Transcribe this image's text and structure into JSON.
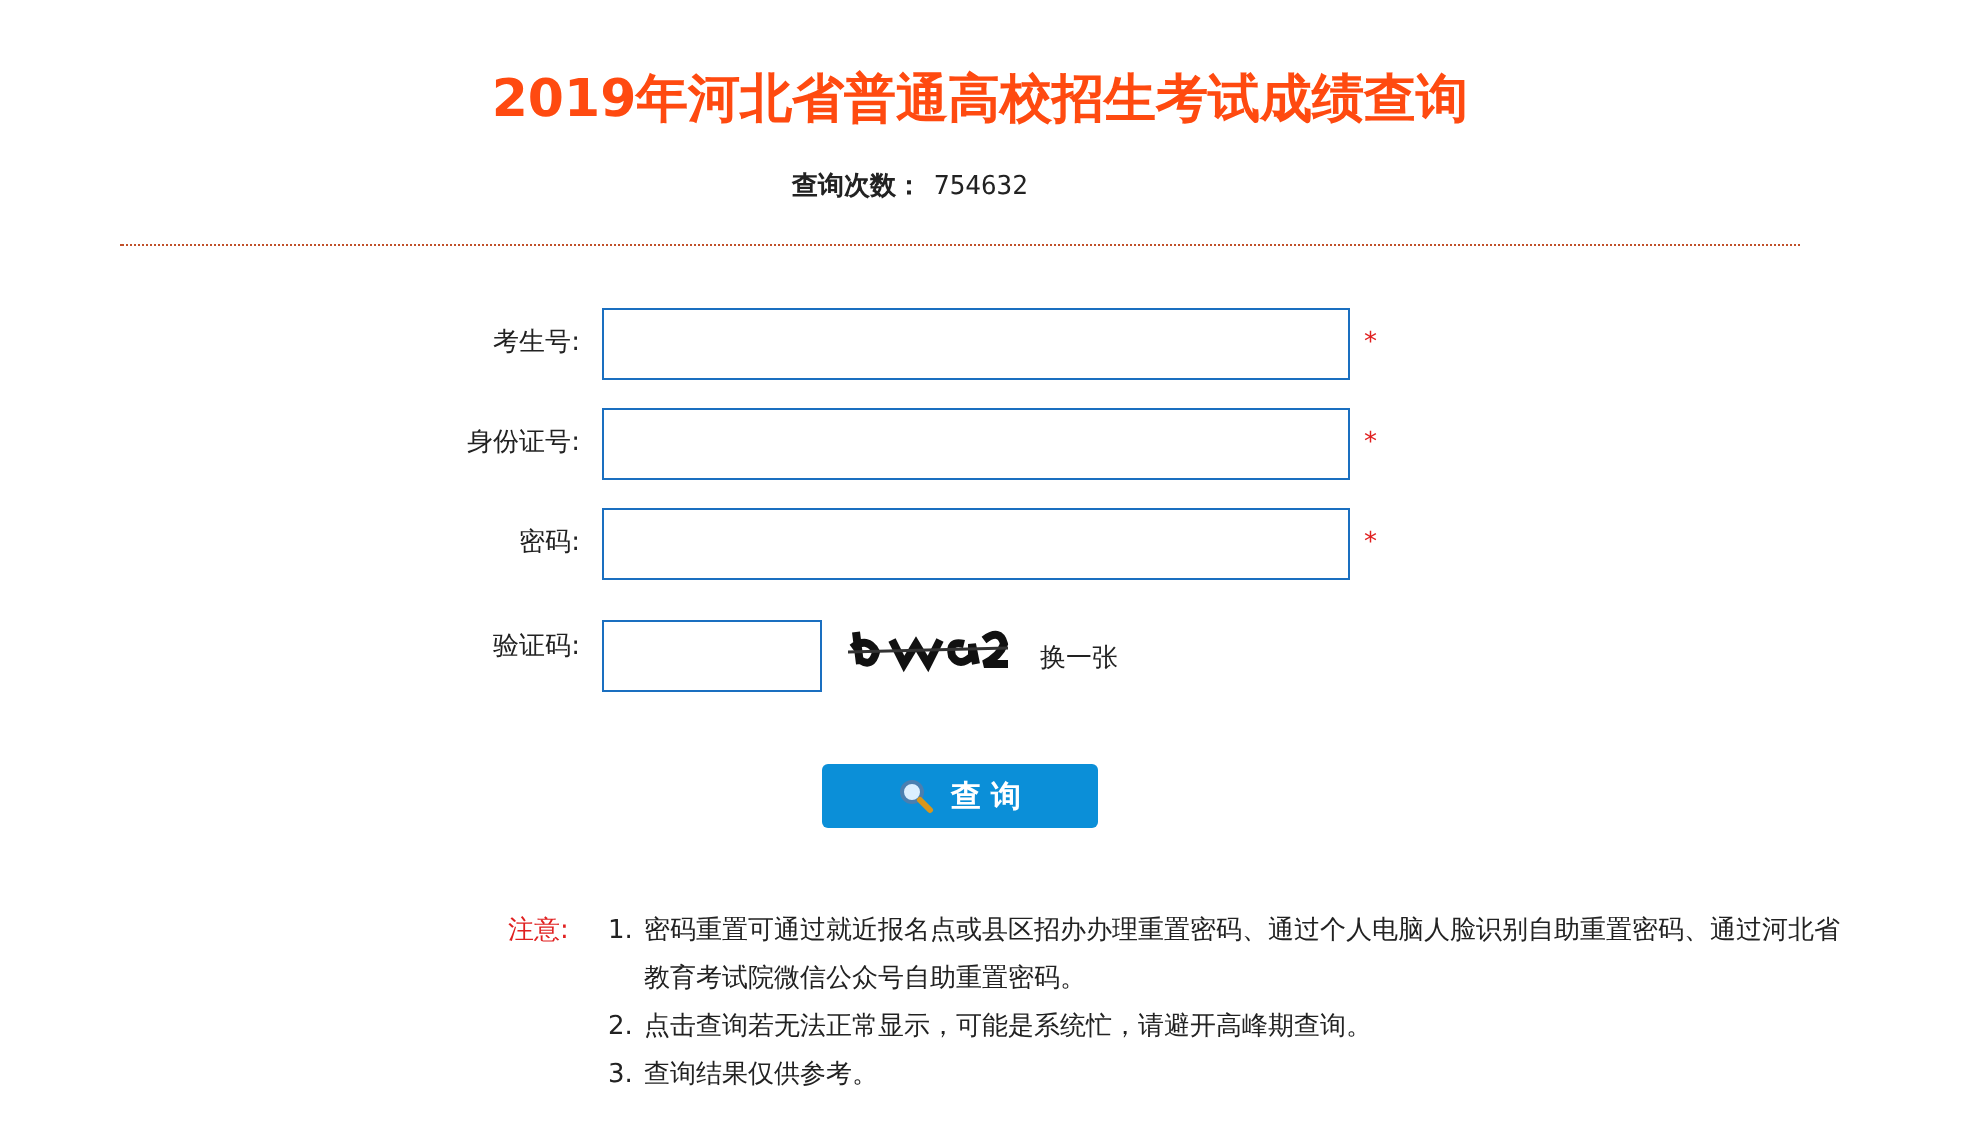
{
  "title": "2019年河北省普通高校招生考试成绩查询",
  "query_count": {
    "label": "查询次数：",
    "value": "754632"
  },
  "fields": [
    {
      "label": "考生号:",
      "required_mark": "*"
    },
    {
      "label": "身份证号:",
      "required_mark": "*"
    },
    {
      "label": "密码:",
      "required_mark": "*"
    }
  ],
  "captcha": {
    "label": "验证码:",
    "refresh": "换一张"
  },
  "submit_button": "查 询",
  "notes": {
    "label": "注意:",
    "items": [
      {
        "number": "1.",
        "text": "密码重置可通过就近报名点或县区招办办理重置密码、通过个人电脑人脸识别自助重置密码、通过河北省教育考试院微信公众号自助重置密码。"
      },
      {
        "number": "2.",
        "text": "点击查询若无法正常显示，可能是系统忙，请避开高峰期查询。"
      },
      {
        "number": "3.",
        "text": "查询结果仅供参考。"
      }
    ]
  }
}
